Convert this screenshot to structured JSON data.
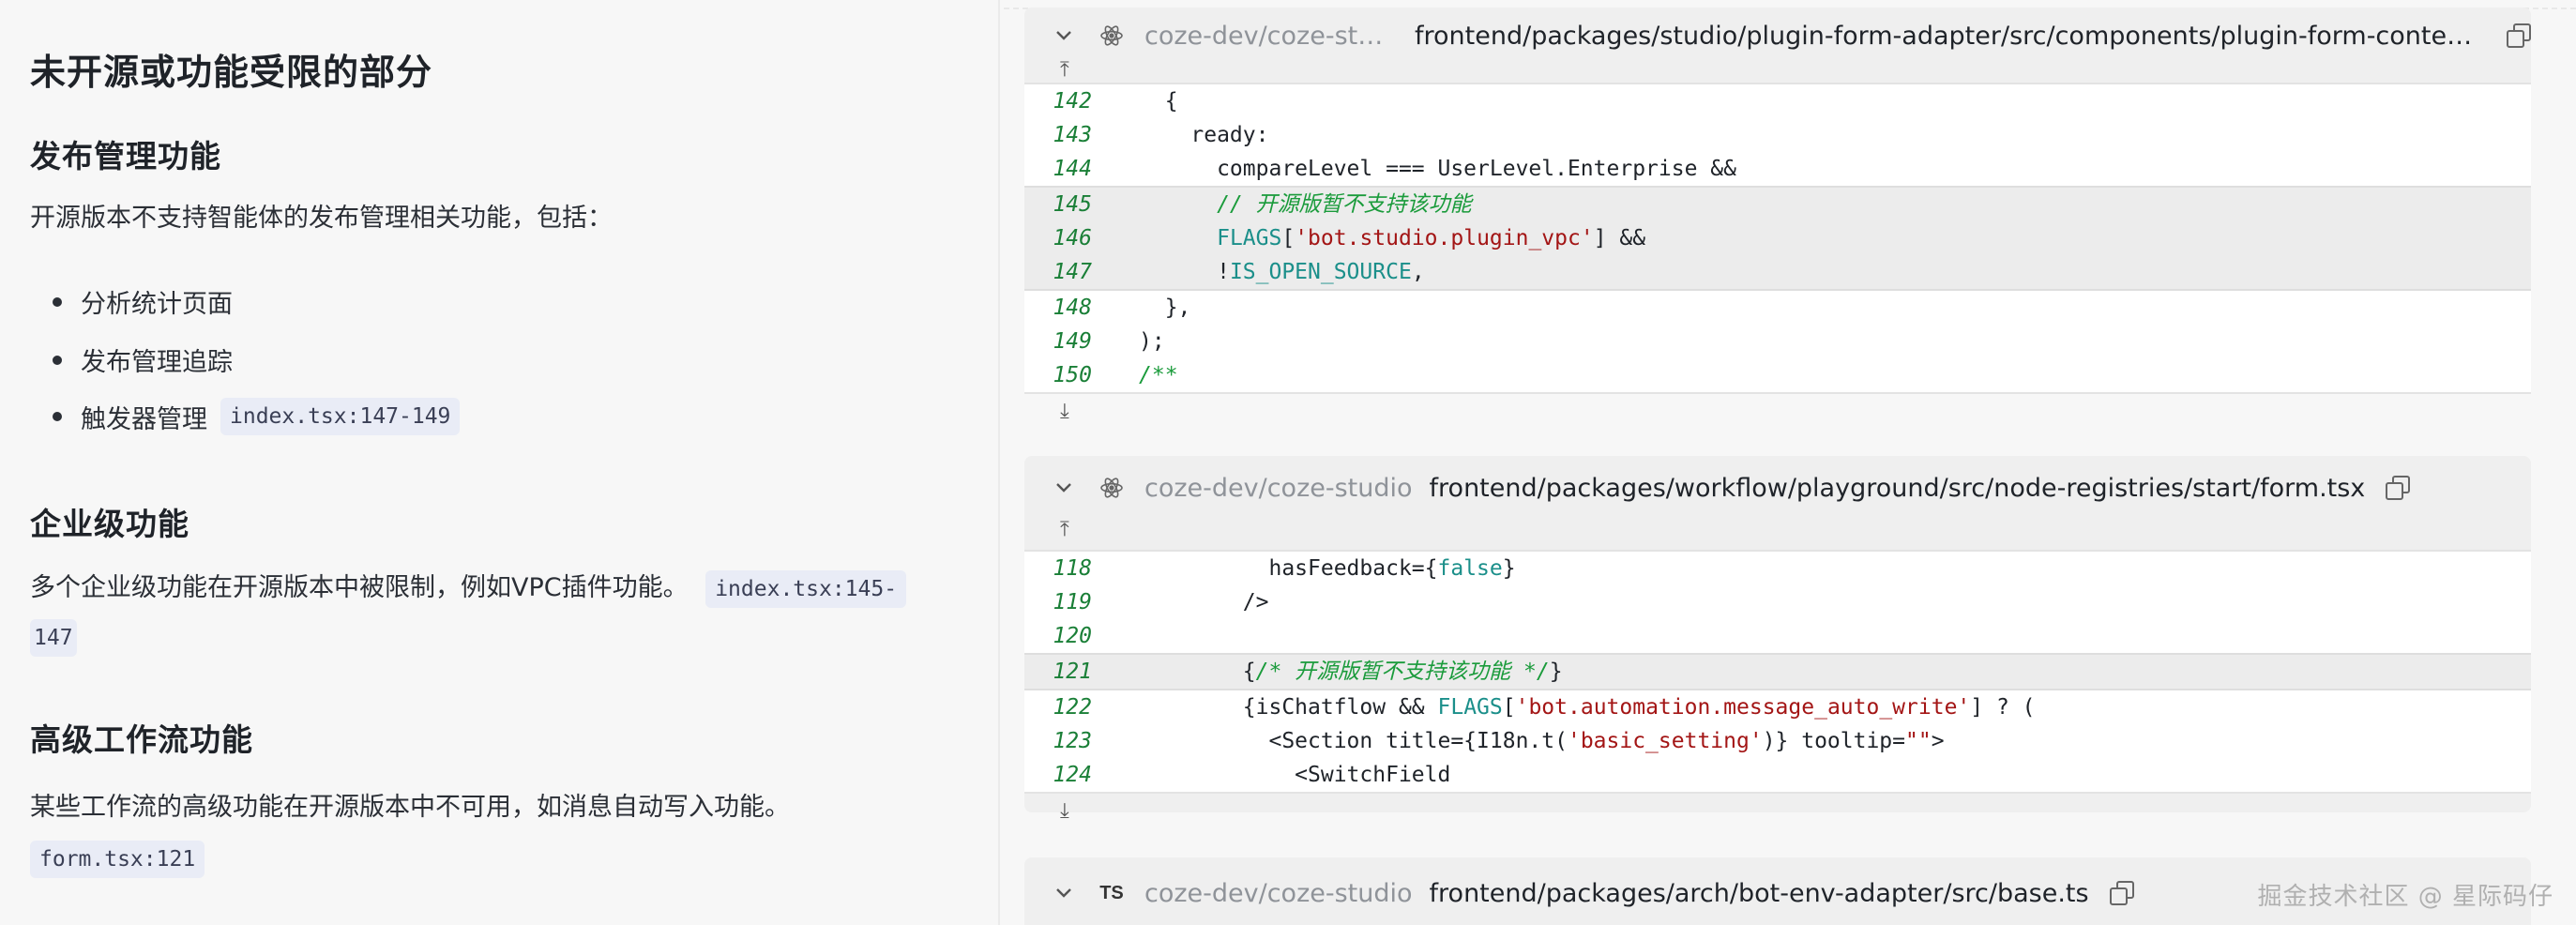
{
  "left": {
    "title": "未开源或功能受限的部分",
    "sections": [
      {
        "heading": "发布管理功能",
        "text": "开源版本不支持智能体的发布管理相关功能，包括：",
        "bullets": [
          "分析统计页面",
          "发布管理追踪",
          "触发器管理"
        ],
        "bullet_ref": "index.tsx:147-149"
      },
      {
        "heading": "企业级功能",
        "text": "多个企业级功能在开源版本中被限制，例如VPC插件功能。",
        "ref_part1": "index.tsx:145-",
        "ref_part2": "147"
      },
      {
        "heading": "高级工作流功能",
        "text": "某些工作流的高级功能在开源版本中不可用，如消息自动写入功能。",
        "ref": "form.tsx:121"
      }
    ]
  },
  "panels": [
    {
      "repo": "coze-dev/coze-stu...",
      "path": "frontend/packages/studio/plugin-form-adapter/src/components/plugin-form-content/...",
      "file_icon": "react-icon",
      "lines": [
        {
          "n": "142",
          "t": "  {"
        },
        {
          "n": "143",
          "t": "    ready:"
        },
        {
          "n": "144",
          "t": "      compareLevel === UserLevel.Enterprise &&"
        },
        {
          "n": "145",
          "t": "      // 开源版暂不支持该功能"
        },
        {
          "n": "146",
          "t": "      FLAGS['bot.studio.plugin_vpc'] &&"
        },
        {
          "n": "147",
          "t": "      !IS_OPEN_SOURCE,"
        },
        {
          "n": "148",
          "t": "  },"
        },
        {
          "n": "149",
          "t": ");"
        },
        {
          "n": "150",
          "t": "/**"
        }
      ]
    },
    {
      "repo": "coze-dev/coze-studio",
      "path": "frontend/packages/workflow/playground/src/node-registries/start/form.tsx",
      "file_icon": "react-icon",
      "lines": [
        {
          "n": "118",
          "t": "          hasFeedback={false}"
        },
        {
          "n": "119",
          "t": "        />"
        },
        {
          "n": "120",
          "t": ""
        },
        {
          "n": "121",
          "t": "        {/* 开源版暂不支持该功能 */}"
        },
        {
          "n": "122",
          "t": "        {isChatflow && FLAGS['bot.automation.message_auto_write'] ? ("
        },
        {
          "n": "123",
          "t": "          <Section title={I18n.t('basic_setting')} tooltip=\"\">"
        },
        {
          "n": "124",
          "t": "            <SwitchField"
        }
      ]
    },
    {
      "repo": "coze-dev/coze-studio",
      "path": "frontend/packages/arch/bot-env-adapter/src/base.ts",
      "file_icon": "TS"
    }
  ],
  "icons": {
    "collapse": "chevron-down-icon",
    "copy": "copy-icon",
    "expand_up": "expand-up-icon",
    "expand_down": "expand-down-icon"
  },
  "watermark": "掘金技术社区 @ 星际码仔"
}
